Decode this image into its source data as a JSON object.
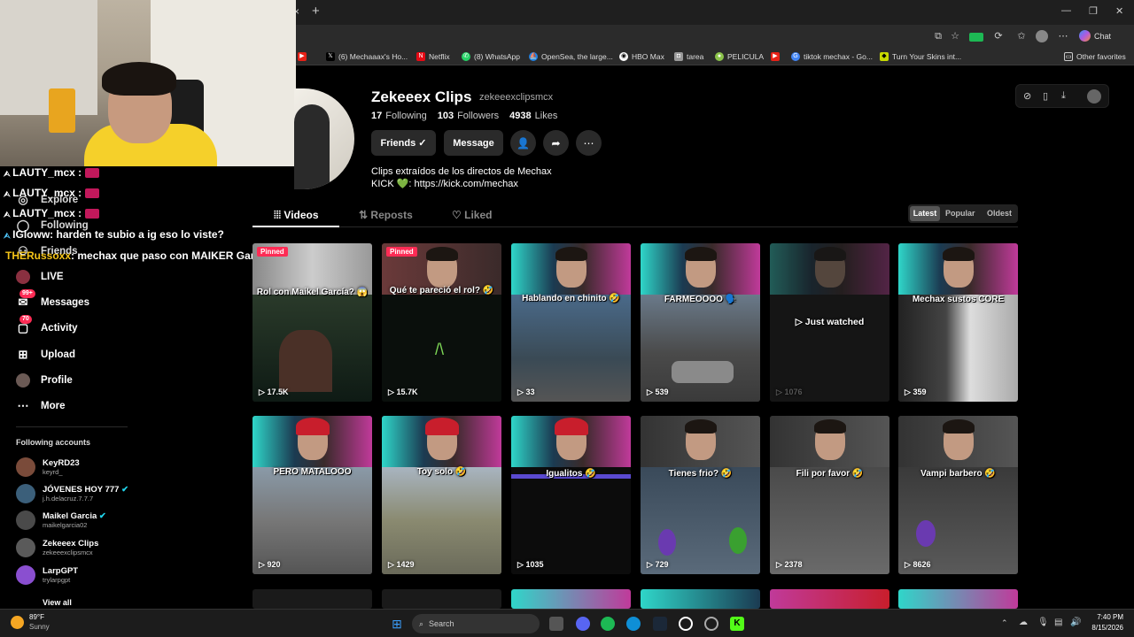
{
  "browser": {
    "bookmarks": [
      "(6) Mechaaax's Ho...",
      "Netflix",
      "(8) WhatsApp",
      "OpenSea, the large...",
      "HBO Max",
      "tarea",
      "PELICULA",
      "tiktok mechax - Go...",
      "Turn Your Skins int..."
    ],
    "other_favorites": "Other favorites",
    "chat_label": "Chat",
    "new_tab": "+",
    "close_tab": "×"
  },
  "profile": {
    "name": "Zekeeex Clips",
    "handle": "zekeeexclipsmcx",
    "following_count": "17",
    "following_label": "Following",
    "followers_count": "103",
    "followers_label": "Followers",
    "likes_count": "4938",
    "likes_label": "Likes",
    "friends_btn": "Friends ✓",
    "message_btn": "Message",
    "bio_line1": "Clips extraídos de los directos de Mechax",
    "bio_line2": "KICK 💚: https://kick.com/mechax"
  },
  "tabs": {
    "videos": "Videos",
    "reposts": "Reposts",
    "liked": "Liked"
  },
  "sort": {
    "latest": "Latest",
    "popular": "Popular",
    "oldest": "Oldest"
  },
  "sidebar": {
    "nav": [
      {
        "label": "Explore",
        "icon": "compass-icon"
      },
      {
        "label": "Following",
        "icon": "following-icon"
      },
      {
        "label": "Friends",
        "icon": "friends-icon"
      },
      {
        "label": "LIVE",
        "icon": "live-icon"
      },
      {
        "label": "Messages",
        "icon": "messages-icon",
        "badge": "99+"
      },
      {
        "label": "Activity",
        "icon": "activity-icon",
        "badge": "70"
      },
      {
        "label": "Upload",
        "icon": "upload-icon"
      },
      {
        "label": "Profile",
        "icon": "profile-icon"
      },
      {
        "label": "More",
        "icon": "more-icon"
      }
    ],
    "following_title": "Following accounts",
    "accounts": [
      {
        "name": "KeyRD23",
        "handle": "keyrd_",
        "color": "#7a4b3a"
      },
      {
        "name": "JÓVENES HOY 777",
        "handle": "j.h.delacruz.7.7.7",
        "color": "#3b5f7a",
        "verified": true
      },
      {
        "name": "Maikel Garcia",
        "handle": "maikelgarcia02",
        "color": "#4a4a4a",
        "verified": true
      },
      {
        "name": "Zekeeex Clips",
        "handle": "zekeeexclipsmcx",
        "color": "#5a5a5a"
      },
      {
        "name": "LarpGPT",
        "handle": "trylarpgpt",
        "color": "#8a4fd0"
      }
    ],
    "view_all": "View all"
  },
  "chat": [
    {
      "user": "LAUTY_mcx :",
      "msg": "",
      "color": "#ffffff"
    },
    {
      "user": "LAUTY_mcx :",
      "msg": "",
      "color": "#ffffff"
    },
    {
      "user": "LAUTY_mcx :",
      "msg": "",
      "color": "#ffffff"
    },
    {
      "user": "IGloww",
      "msg": ": harden te subio a ig eso lo viste?",
      "color": "#ffffff"
    },
    {
      "user": "THERussoxx",
      "msg": ": mechax que paso con MAIKER Garcia???",
      "color": "#f5c518"
    }
  ],
  "videos": [
    {
      "caption": "Rol con Maikel García? 😱",
      "views": "17.5K",
      "pinned": "Pinned"
    },
    {
      "caption": "Qué te pareció el rol? 🤣",
      "views": "15.7K",
      "pinned": "Pinned"
    },
    {
      "caption": "Hablando en chinito 🤣",
      "views": "33"
    },
    {
      "caption": "FARMEOOOO 🗣️",
      "views": "539"
    },
    {
      "caption": "Just watched",
      "views": "1076"
    },
    {
      "caption": "Mechax sustos CORE",
      "views": "359"
    },
    {
      "caption": "PERO MATALOOO",
      "views": "920"
    },
    {
      "caption": "Toy solo 🤣",
      "views": "1429"
    },
    {
      "caption": "Igualitos 🤣",
      "views": "1035"
    },
    {
      "caption": "Tienes frio? 🤣",
      "views": "729"
    },
    {
      "caption": "Fili por favor 🤣",
      "views": "2378"
    },
    {
      "caption": "Vampi barbero 🤣",
      "views": "8626"
    }
  ],
  "taskbar": {
    "weather_temp": "89°F",
    "weather_desc": "Sunny",
    "search": "Search",
    "time": "7:40 PM",
    "date": "8/15/2026"
  }
}
